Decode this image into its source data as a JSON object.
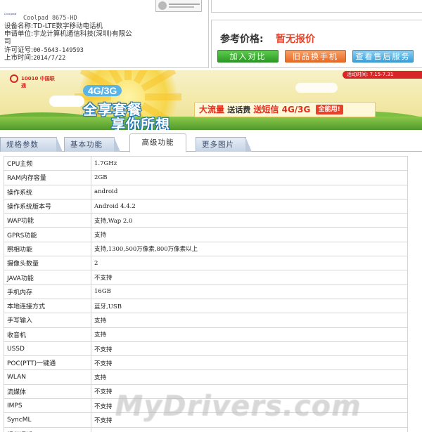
{
  "info": {
    "logo_text": "Coolpad",
    "model_line": "Coolpad 8675-HD",
    "device_label": "设备名称:",
    "device_value": "TD-LTE数字移动电话机",
    "applicant_label": "申请单位:",
    "applicant_value_line1": "宇龙计算机通信科技(深圳)有限公",
    "applicant_value_line2": "司",
    "license_label": "许可证号:",
    "license_value": "00-5643-149593",
    "date_label": "上市时间:",
    "date_value": "2014/7/22"
  },
  "price": {
    "label": "参考价格:",
    "value": "暂无报价",
    "buttons": {
      "compare": "加入对比",
      "recycle": "旧品换手机",
      "service": "查看售后服务"
    }
  },
  "banner": {
    "logo_text": "10010 中国联通",
    "activity_time": "活动时间: 7.15-7.31",
    "badge": "4G/3G",
    "slogan_line1": "全享套餐",
    "slogan_line2": "享你所想",
    "promo_part1": "大流量",
    "promo_part2": "送话费",
    "promo_part3": "送短信",
    "promo_part4": "4G/3G",
    "promo_part5": "全能用!"
  },
  "tabs": [
    "规格参数",
    "基本功能",
    "高级功能",
    "更多图片"
  ],
  "specs": [
    {
      "k": "CPU主频",
      "v": "1.7GHz"
    },
    {
      "k": "RAM内存容量",
      "v": "2GB"
    },
    {
      "k": "操作系统",
      "v": "android"
    },
    {
      "k": "操作系统版本号",
      "v": "Android 4.4.2"
    },
    {
      "k": "WAP功能",
      "v": "支持,Wap 2.0"
    },
    {
      "k": "GPRS功能",
      "v": "支持"
    },
    {
      "k": "照相功能",
      "v": "支持,1300,500万像素,800万像素以上"
    },
    {
      "k": "摄像头数量",
      "v": "2"
    },
    {
      "k": "JAVA功能",
      "v": "不支持"
    },
    {
      "k": "手机内存",
      "v": "16GB"
    },
    {
      "k": "本地连接方式",
      "v": "蓝牙,USB"
    },
    {
      "k": "手写输入",
      "v": "支持"
    },
    {
      "k": "收音机",
      "v": "支持"
    },
    {
      "k": "USSD",
      "v": "不支持"
    },
    {
      "k": "POC(PTT)一键通",
      "v": "不支持"
    },
    {
      "k": "WLAN",
      "v": "支持"
    },
    {
      "k": "流媒体",
      "v": "不支持"
    },
    {
      "k": "IMPS",
      "v": "不支持"
    },
    {
      "k": "SyncML",
      "v": "不支持"
    },
    {
      "k": "视频通话",
      "v": ""
    }
  ],
  "watermark": "MyDrivers.com"
}
